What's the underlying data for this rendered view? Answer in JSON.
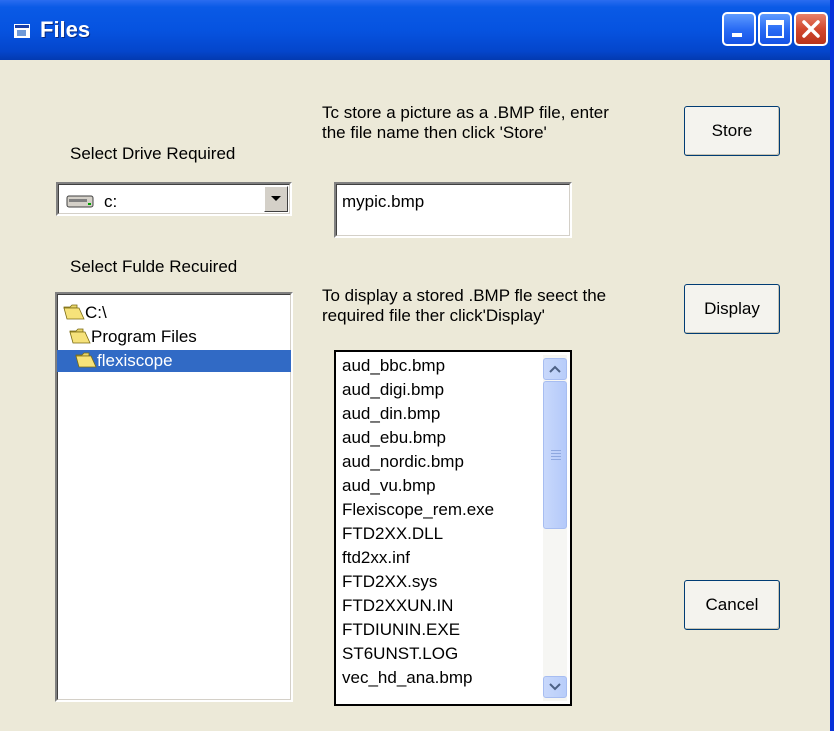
{
  "window": {
    "title": "Files",
    "controls": {
      "minimize_icon": "minimize-icon",
      "maximize_icon": "maximize-icon",
      "close_icon": "close-icon"
    },
    "colors": {
      "titlebar": "#0653e0",
      "face": "#ece9d8",
      "selection": "#316ac5"
    }
  },
  "drive": {
    "label": "Select Drive Required",
    "value": "c:",
    "icon": "drive-icon"
  },
  "folders": {
    "label": "Select Fulde Recuired",
    "items": [
      {
        "name": "C:\\",
        "icon": "open-folder-icon",
        "selected": false
      },
      {
        "name": "Program Files",
        "icon": "open-folder-icon",
        "selected": false
      },
      {
        "name": "flexiscope",
        "icon": "open-folder-icon",
        "selected": true
      }
    ]
  },
  "store": {
    "instruction_line1": "Tc store a picture as a .BMP file, enter",
    "instruction_line2": "the file name then click 'Store'",
    "filename_value": "mypic.bmp",
    "button_label": "Store"
  },
  "display": {
    "instruction_line1": "To display a stored .BMP fle seect the",
    "instruction_line2": "required file ther click'Display'",
    "button_label": "Display",
    "files": [
      "aud_bbc.bmp",
      "aud_digi.bmp",
      "aud_din.bmp",
      "aud_ebu.bmp",
      "aud_nordic.bmp",
      "aud_vu.bmp",
      "Flexiscope_rem.exe",
      "FTD2XX.DLL",
      "ftd2xx.inf",
      "FTD2XX.sys",
      "FTD2XXUN.IN",
      "FTDIUNIN.EXE",
      "ST6UNST.LOG",
      "vec_hd_ana.bmp"
    ]
  },
  "cancel": {
    "button_label": "Cancel"
  }
}
